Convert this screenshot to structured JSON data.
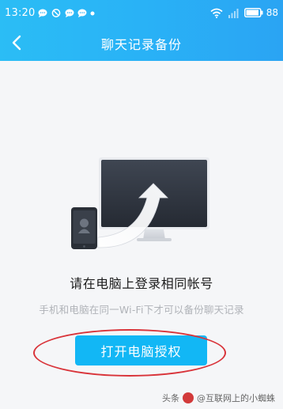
{
  "status_bar": {
    "time": "13:20",
    "battery": "88"
  },
  "titlebar": {
    "title": "聊天记录备份",
    "back_icon": "chevron-left-icon"
  },
  "content": {
    "heading": "请在电脑上登录相同帐号",
    "subtext": "手机和电脑在同一Wi-Fi下才可以备份聊天记录",
    "button_label": "打开电脑授权"
  },
  "watermark": {
    "prefix": "头条",
    "at": "@",
    "author": "互联网上的小蜘蛛"
  },
  "colors": {
    "header_gradient_start": "#2bbdf5",
    "header_gradient_end": "#2aa4f3",
    "button": "#12b7f5",
    "highlight": "#d9343a",
    "background": "#f5f6f8"
  }
}
